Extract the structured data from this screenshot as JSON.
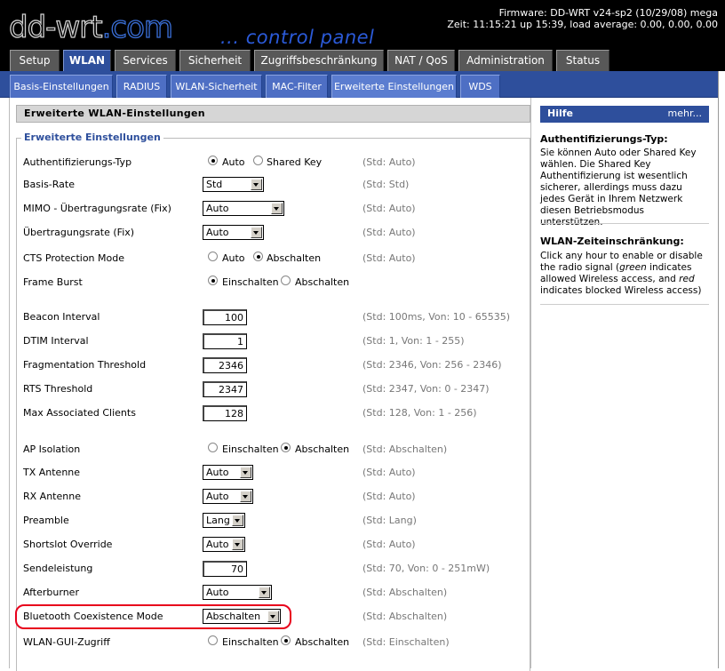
{
  "header": {
    "logo_main": "dd-wrt",
    "logo_com": ".com",
    "tagline": "... control panel",
    "firmware": "Firmware: DD-WRT v24-sp2 (10/29/08) mega",
    "time": "Zeit: 11:15:21 up 15:39, load average: 0.00, 0.00, 0.00"
  },
  "main_tabs": [
    "Setup",
    "WLAN",
    "Services",
    "Sicherheit",
    "Zugriffsbeschränkung",
    "NAT / QoS",
    "Administration",
    "Status"
  ],
  "sub_tabs": [
    "Basis-Einstellungen",
    "RADIUS",
    "WLAN-Sicherheit",
    "MAC-Filter",
    "Erweiterte Einstellungen",
    "WDS"
  ],
  "page": {
    "title": "Erweiterte WLAN-Einstellungen",
    "legend": "Erweiterte Einstellungen",
    "rows": {
      "auth_type": {
        "label": "Authentifizierungs-Typ",
        "opt1": "Auto",
        "opt2": "Shared Key",
        "std": "(Std: Auto)"
      },
      "basic_rate": {
        "label": "Basis-Rate",
        "value": "Std",
        "std": "(Std: Std)"
      },
      "mimo_rate": {
        "label": "MIMO - Übertragungsrate (Fix)",
        "value": "Auto",
        "std": "(Std: Auto)"
      },
      "tx_rate": {
        "label": "Übertragungsrate (Fix)",
        "value": "Auto",
        "std": "(Std: Auto)"
      },
      "cts": {
        "label": "CTS Protection Mode",
        "opt1": "Auto",
        "opt2": "Abschalten",
        "std": "(Std: Auto)"
      },
      "frame_burst": {
        "label": "Frame Burst",
        "opt1": "Einschalten",
        "opt2": "Abschalten"
      },
      "beacon": {
        "label": "Beacon Interval",
        "value": "100",
        "std": "(Std: 100ms, Von: 10 - 65535)"
      },
      "dtim": {
        "label": "DTIM Interval",
        "value": "1",
        "std": "(Std: 1, Von: 1 - 255)"
      },
      "frag": {
        "label": "Fragmentation Threshold",
        "value": "2346",
        "std": "(Std: 2346, Von: 256 - 2346)"
      },
      "rts": {
        "label": "RTS Threshold",
        "value": "2347",
        "std": "(Std: 2347, Von: 0 - 2347)"
      },
      "max_clients": {
        "label": "Max Associated Clients",
        "value": "128",
        "std": "(Std: 128, Von: 1 - 256)"
      },
      "ap_iso": {
        "label": "AP Isolation",
        "opt1": "Einschalten",
        "opt2": "Abschalten",
        "std": "(Std: Abschalten)"
      },
      "tx_ant": {
        "label": "TX Antenne",
        "value": "Auto",
        "std": "(Std: Auto)"
      },
      "rx_ant": {
        "label": "RX Antenne",
        "value": "Auto",
        "std": "(Std: Auto)"
      },
      "preamble": {
        "label": "Preamble",
        "value": "Lang",
        "std": "(Std: Lang)"
      },
      "shortslot": {
        "label": "Shortslot Override",
        "value": "Auto",
        "std": "(Std: Auto)"
      },
      "txpower": {
        "label": "Sendeleistung",
        "value": "70",
        "std": "(Std: 70, Von: 0 - 251mW)"
      },
      "afterburner": {
        "label": "Afterburner",
        "value": "Auto",
        "std": "(Std: Abschalten)"
      },
      "bt_coex": {
        "label": "Bluetooth Coexistence Mode",
        "value": "Abschalten",
        "std": "(Std: Abschalten)"
      },
      "gui_access": {
        "label": "WLAN-GUI-Zugriff",
        "opt1": "Einschalten",
        "opt2": "Abschalten",
        "std": "(Std: Einschalten)"
      }
    }
  },
  "sidebar": {
    "title": "Hilfe",
    "more": "mehr...",
    "s1_head": "Authentifizierungs-Typ:",
    "s1_text": "Sie können Auto oder Shared Key wählen. Die Shared Key Authentifizierung ist wesentlich sicherer, allerdings muss dazu jedes Gerät in Ihrem Netzwerk diesen Betriebsmodus unterstützen.",
    "s2_head": "WLAN-Zeiteinschränkung:",
    "s2_text_a": "Click any hour to enable or disable the radio signal (",
    "s2_green": "green",
    "s2_text_b": " indicates allowed Wireless access, and ",
    "s2_red": "red",
    "s2_text_c": " indicates blocked Wireless access)"
  },
  "colors": {
    "accent": "#2e4f9c",
    "highlight": "#e8001c"
  }
}
